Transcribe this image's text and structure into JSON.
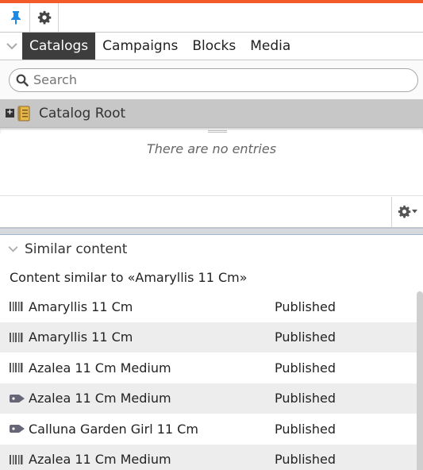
{
  "toolbar": {
    "pin_icon": "pin-icon",
    "settings_icon": "gear-icon"
  },
  "tabs": [
    {
      "label": "Catalogs",
      "active": true
    },
    {
      "label": "Campaigns",
      "active": false
    },
    {
      "label": "Blocks",
      "active": false
    },
    {
      "label": "Media",
      "active": false
    }
  ],
  "search": {
    "placeholder": "Search",
    "value": ""
  },
  "tree": {
    "root_label": "Catalog Root",
    "expander": "+"
  },
  "entries": {
    "empty_message": "There are no entries"
  },
  "similar": {
    "section_title": "Similar content",
    "subtitle": "Content similar to «Amaryllis 11 Cm»",
    "items": [
      {
        "name": "Amaryllis 11 Cm",
        "status": "Published",
        "icon": "barcode-icon"
      },
      {
        "name": "Amaryllis 11 Cm",
        "status": "Published",
        "icon": "barcode-icon"
      },
      {
        "name": "Azalea 11 Cm Medium",
        "status": "Published",
        "icon": "barcode-icon"
      },
      {
        "name": "Azalea 11 Cm Medium",
        "status": "Published",
        "icon": "price-tag-icon"
      },
      {
        "name": "Calluna Garden Girl 11 Cm",
        "status": "Published",
        "icon": "price-tag-icon"
      },
      {
        "name": "Azalea 11 Cm Medium",
        "status": "Published",
        "icon": "barcode-icon"
      }
    ]
  },
  "colors": {
    "accent_bar": "#f35b2a",
    "pin": "#1e88e5",
    "active_tab": "#3d3d3d",
    "selected_row": "#c7c7c7"
  }
}
